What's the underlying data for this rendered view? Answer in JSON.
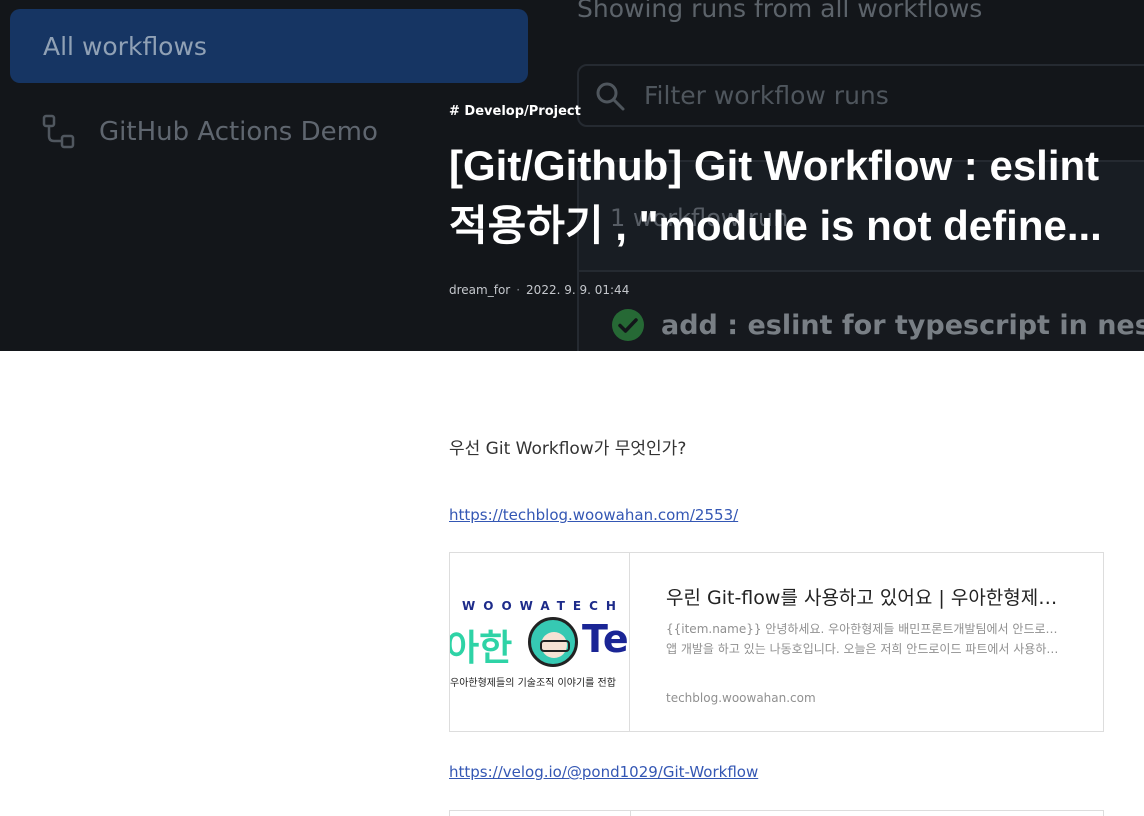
{
  "background_screenshot": {
    "sidebar_active_label": "All workflows",
    "sidebar_workflow_label": "GitHub Actions Demo",
    "showing_text": "Showing runs from all workflows",
    "filter_placeholder": "Filter workflow runs",
    "runs_count": "1 workflow run",
    "run_title": "add : eslint for typescript in nestjs"
  },
  "post": {
    "category": "# Develop/Project",
    "title_line1": "[Git/Github] Git Workflow : eslint",
    "title_line2": "적용하기 , \"module is not define...",
    "author": "dream_for",
    "separator": "·",
    "date": "2022. 9. 9. 01:44"
  },
  "article": {
    "intro": "우선 Git Workflow가 무엇인가?",
    "link1": "https://techblog.woowahan.com/2553/",
    "card": {
      "thumb_letters": "WOOWATECH",
      "thumb_hangul": "아한",
      "thumb_tec": "Tec",
      "thumb_caption": "우아한형제들의 기술조직 이야기를 전합",
      "title": "우린 Git-flow를 사용하고 있어요 | 우아한형제들 기술블로그",
      "desc_line1": "{{item.name}} 안녕하세요. 우아한형제들 배민프론트개발팀에서 안드로이드",
      "desc_line2": "앱 개발을 하고 있는 나동호입니다. 오늘은 저희 안드로이드 파트에서 사용하고 있는",
      "domain": "techblog.woowahan.com"
    },
    "link2": "https://velog.io/@pond1029/Git-Workflow"
  },
  "colors": {
    "hero_bg": "#16181d",
    "active_item": "#193d73",
    "link": "#3457b4",
    "success": "#2ea043"
  }
}
